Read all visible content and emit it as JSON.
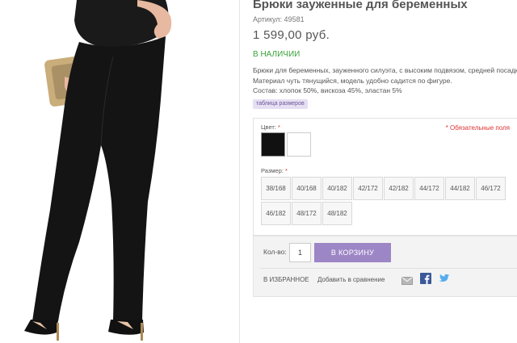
{
  "product": {
    "title": "Брюки зауженные для беременных",
    "sku": "Артикул: 49581",
    "price": "1 599,00 руб.",
    "stock_status": "В НАЛИЧИИ",
    "description_lines": [
      "Брюки для беременных, зауженного силуэта, с высоким подвязом, средней посадки.",
      "Материал чуть тянущийся, модель удобно садится по фигуре.",
      "Состав: хлопок 50%, вискоза 45%, эластан 5%"
    ],
    "size_table_link": "таблица размеров"
  },
  "options": {
    "color_label": "Цвет:",
    "required_star": "*",
    "required_note": "* Обязательные поля",
    "colors": [
      {
        "name": "black",
        "hex": "#111111"
      },
      {
        "name": "white",
        "hex": "#ffffff"
      }
    ],
    "size_label": "Размер:",
    "sizes": [
      "38/168",
      "40/168",
      "40/182",
      "42/172",
      "42/182",
      "44/172",
      "44/182",
      "46/172",
      "46/182",
      "48/172",
      "48/182"
    ]
  },
  "cart": {
    "qty_label": "Кол-во:",
    "qty_value": "1",
    "add_to_cart": "В КОРЗИНУ",
    "favorites": "В ИЗБРАННОЕ",
    "compare": "Добавить в сравнение",
    "share_icons": [
      "mail-icon",
      "facebook-icon",
      "twitter-icon"
    ]
  },
  "colors": {
    "accent": "#9d86c6",
    "in_stock": "#3aa33a",
    "required": "#dd3333"
  }
}
